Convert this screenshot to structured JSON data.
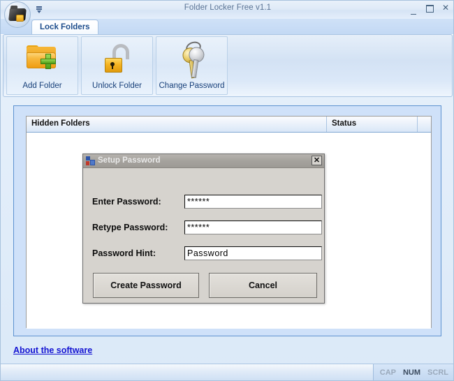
{
  "window": {
    "title": "Folder Locker Free v1.1",
    "app_icon": "folder-lock-icon",
    "qat_dropdown_icon": "customize-quick-access-icon",
    "minimize_label": "Minimize",
    "maximize_label": "Maximize",
    "close_label": "Close"
  },
  "tabs": [
    {
      "label": "Lock Folders",
      "selected": true
    }
  ],
  "ribbon": {
    "buttons": [
      {
        "label": "Add Folder",
        "icon": "folder-add-icon"
      },
      {
        "label": "Unlock Folder",
        "icon": "open-padlock-icon"
      },
      {
        "label": "Change Password",
        "icon": "keys-icon"
      }
    ]
  },
  "list": {
    "columns": [
      {
        "label": "Hidden Folders"
      },
      {
        "label": "Status"
      },
      {
        "label": ""
      }
    ],
    "rows": []
  },
  "footer": {
    "about_link": "About the software"
  },
  "statusbar": {
    "indicators": [
      {
        "label": "CAP",
        "active": false
      },
      {
        "label": "NUM",
        "active": true
      },
      {
        "label": "SCRL",
        "active": false
      }
    ]
  },
  "dialog": {
    "title": "Setup Password",
    "icon": "winforms-icon",
    "close_label": "✕",
    "fields": [
      {
        "label": "Enter Password:",
        "value": "******",
        "placeholder": ""
      },
      {
        "label": "Retype Password:",
        "value": "******",
        "placeholder": ""
      },
      {
        "label": "Password Hint:",
        "value": "Password",
        "placeholder": ""
      }
    ],
    "buttons": [
      {
        "label": "Create Password"
      },
      {
        "label": "Cancel"
      }
    ]
  },
  "colors": {
    "window_chrome": "#dbe9f8",
    "ribbon_border": "#a9c4e2",
    "tab_text": "#1e4d8c",
    "link": "#1414d2",
    "dialog_face": "#d6d3ce",
    "dialog_titlebar": "#a5a29d",
    "listpanel_border": "#5d92d0"
  }
}
